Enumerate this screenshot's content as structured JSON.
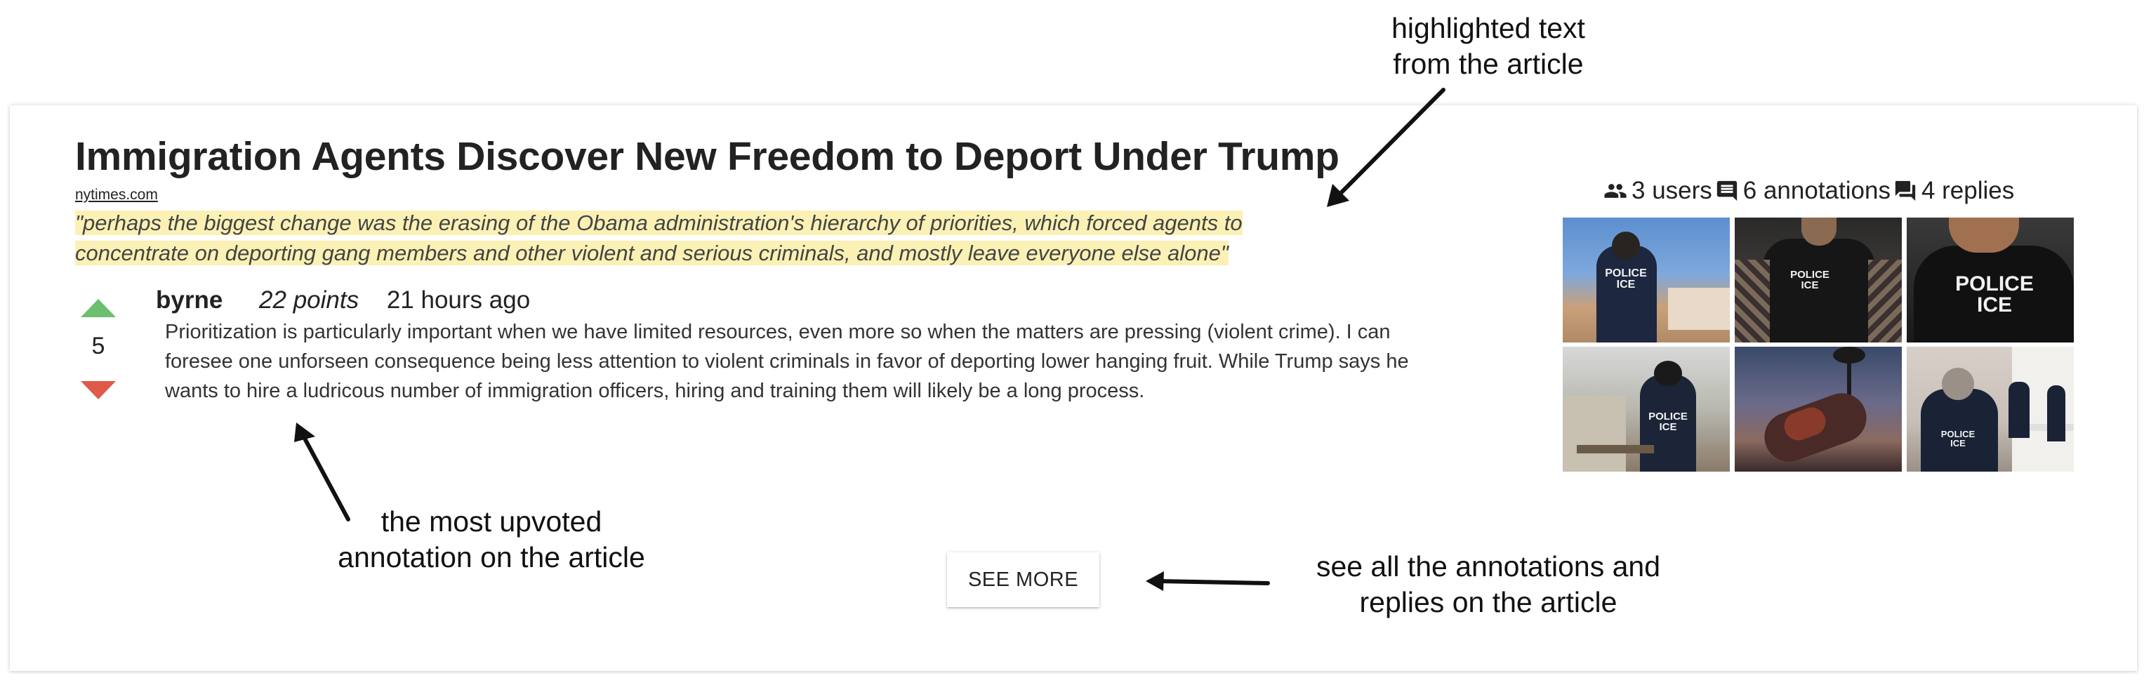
{
  "article": {
    "title": "Immigration Agents Discover New Freedom to Deport Under Trump",
    "source": "nytimes.com",
    "highlight": "\"perhaps the biggest change was the erasing of the Obama administration's hierarchy of priorities, which forced agents to concentrate on deporting gang members and other violent and serious criminals, and mostly leave everyone else alone\""
  },
  "top_annotation": {
    "votes": "5",
    "author": "byrne",
    "points": "22 points",
    "time": "21 hours ago",
    "text": "Prioritization is particularly important when we have limited resources, even more so when the matters are pressing (violent crime). I can foresee one unforseen consequence being less attention to violent criminals in favor of deporting lower hanging fruit. While Trump says he wants to hire a ludricous number of immigration officers, hiring and training them will likely be a long process."
  },
  "stats": {
    "users": "3 users",
    "annotations": "6 annotations",
    "replies": "4 replies"
  },
  "thumbnails": [
    {
      "label": "POLICE ICE"
    },
    {
      "label": "POLICE ICE"
    },
    {
      "label": "POLICE ICE"
    },
    {
      "label": "POLICE ICE"
    },
    {
      "label": ""
    },
    {
      "label": "POLICE ICE"
    }
  ],
  "see_more_label": "SEE MORE",
  "callouts": {
    "highlight": "highlighted text\nfrom the article",
    "top_annotation": "the most upvoted\nannotation on the article",
    "see_more": "see all the annotations and\nreplies on the article"
  },
  "colors": {
    "highlight": "#fbf1b5",
    "upvote": "#6cbf6c",
    "downvote": "#e05a4a"
  },
  "icons": {
    "users": "people-icon",
    "annotations": "comment-icon",
    "replies": "forum-icon"
  }
}
